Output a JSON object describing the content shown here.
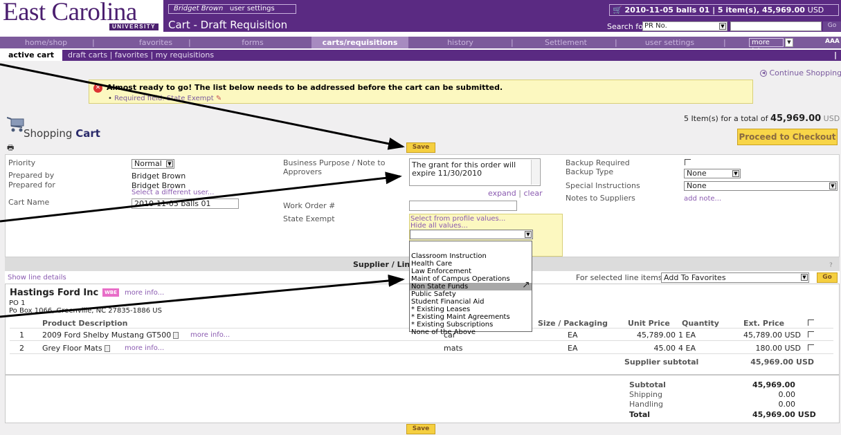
{
  "header": {
    "logo_text": "East Carolina",
    "logo_subtext": "UNIVERSITY",
    "user_name": "Bridget Brown",
    "user_settings_link": "user settings",
    "page_title": "Cart - Draft Requisition",
    "cart_summary": "2010-11-05 balls 01 | 5 item(s), 45,969.00",
    "cart_summary_currency": "USD",
    "search_label": "Search for",
    "search_option": "PR No.",
    "search_go": "Go"
  },
  "nav": {
    "items": [
      "home/shop",
      "favorites",
      "forms",
      "carts/requisitions",
      "history",
      "Settlement",
      "user settings"
    ],
    "more": "more >>",
    "font_icon": "AAA"
  },
  "subnav": {
    "active": "active cart",
    "others": "draft carts  |  favorites  |  my requisitions",
    "help": "?"
  },
  "content": {
    "continue_shopping": "Continue Shopping",
    "warning_text": "Almost ready to go! The list below needs to be addressed before the cart can be submitted.",
    "warning_item": "Required field: State Exempt",
    "items_total_prefix": "5 Item(s)  for a total of",
    "items_total_value": "45,969.00",
    "items_total_currency": "USD",
    "heading_part1": "Shopping",
    "heading_part2": "Cart",
    "checkout_label": "Proceed to Checkout",
    "save_label": "Save"
  },
  "form": {
    "priority_label": "Priority",
    "priority_value": "Normal",
    "prepared_by_label": "Prepared by",
    "prepared_by_value": "Bridget Brown",
    "prepared_for_label": "Prepared for",
    "prepared_for_value": "Bridget Brown",
    "select_user_link": "Select a different user...",
    "cart_name_label": "Cart Name",
    "cart_name_value": "2010-11-05 balls 01",
    "purpose_label_1": "Business Purpose / Note to",
    "purpose_label_2": "Approvers",
    "purpose_value": "The grant for this order will expire 11/30/2010",
    "expand_link": "expand",
    "clear_link": "clear",
    "work_order_label": "Work Order #",
    "state_exempt_label": "State Exempt",
    "select_profile_link": "Select from profile values...",
    "hide_values_link": "Hide all values...",
    "backup_required_label": "Backup Required",
    "backup_type_label": "Backup Type",
    "backup_type_value": "None",
    "special_instructions_label": "Special Instructions",
    "special_instructions_value": "None",
    "notes_label": "Notes to Suppliers",
    "add_note_link": "add note..."
  },
  "state_exempt_options": [
    "",
    "Classroom Instruction",
    "Health Care",
    "Law Enforcement",
    "Maint of Campus Operations",
    "Non State Funds",
    "Public Safety",
    "Student Financial Aid",
    "* Existing Leases",
    "* Existing Maint Agreements",
    "* Existing Subscriptions",
    "None of the Above"
  ],
  "state_exempt_highlighted": "Non State Funds",
  "supplier_bar": {
    "title": "Supplier / Line",
    "show_line_details": "Show line details",
    "for_selected_label": "For selected line items",
    "for_selected_value": "Add To Favorites",
    "go": "Go",
    "help": "?"
  },
  "supplier": {
    "name": "Hastings Ford Inc",
    "badge": "WBE",
    "more_info": "more info...",
    "po": "PO 1",
    "address": "Po Box 1066, Greenville, NC 27835-1886 US"
  },
  "table": {
    "headers": {
      "product": "Product Description",
      "size": "Size / Packaging",
      "unit_price": "Unit Price",
      "quantity": "Quantity",
      "ext_price": "Ext. Price"
    },
    "rows": [
      {
        "num": "1",
        "desc": "2009 Ford Shelby Mustang GT500",
        "more": "more info...",
        "catalog": "car",
        "size": "EA",
        "unit_price": "45,789.00",
        "qty": "1 EA",
        "ext_price": "45,789.00 USD"
      },
      {
        "num": "2",
        "desc": "Grey Floor Mats",
        "more": "more info...",
        "catalog": "mats",
        "size": "EA",
        "unit_price": "45.00",
        "qty": "4 EA",
        "ext_price": "180.00 USD"
      }
    ],
    "supplier_subtotal_label": "Supplier subtotal",
    "supplier_subtotal_value": "45,969.00 USD"
  },
  "totals": {
    "subtotal_label": "Subtotal",
    "subtotal_value": "45,969.00",
    "shipping_label": "Shipping",
    "shipping_value": "0.00",
    "handling_label": "Handling",
    "handling_value": "0.00",
    "total_label": "Total",
    "total_value": "45,969.00 USD"
  },
  "colors": {
    "brand_purple": "#5a2a82",
    "nav_purple": "#7c5a9b",
    "warning_yellow": "#fcf8c0",
    "button_gold": "#f5cf40"
  }
}
